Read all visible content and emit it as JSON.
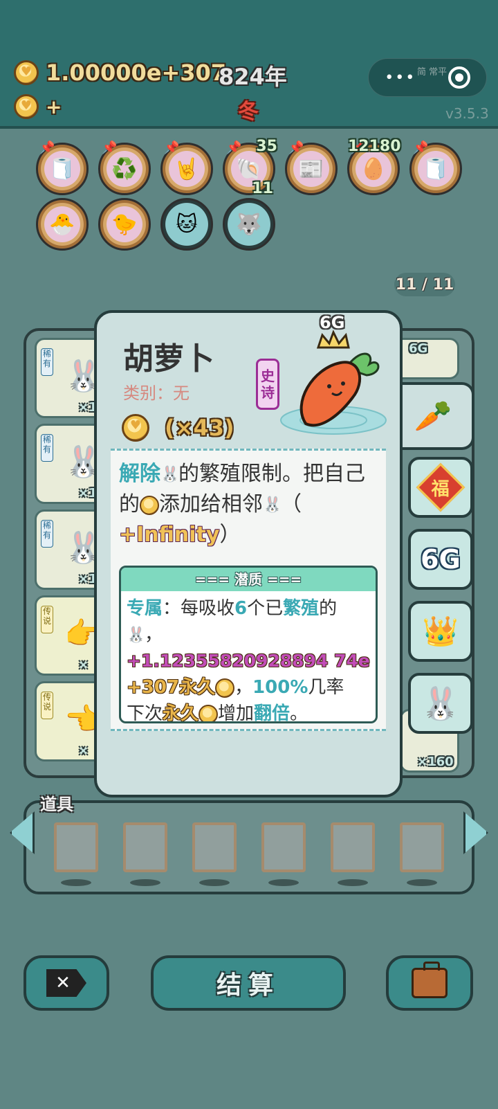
{
  "header": {
    "gold_value": "1.00000e+307",
    "gold_plus": "+",
    "year": "824年",
    "season": "冬",
    "version": "v3.5.3",
    "capsule_dots": "•••",
    "capsule_overlay": "简 常平"
  },
  "relics": [
    {
      "name": "tissue-box",
      "icon": "🧻"
    },
    {
      "name": "recycle",
      "icon": "♻️"
    },
    {
      "name": "rock-hand",
      "icon": "🤘"
    },
    {
      "name": "shell",
      "icon": "🐚",
      "count_top": "35",
      "count_bottom": "11"
    },
    {
      "name": "time-magazine",
      "icon": "📰"
    },
    {
      "name": "egg-tray",
      "icon": "🥚",
      "count_top": "12180"
    },
    {
      "name": "tissue-box-2",
      "icon": "🧻"
    },
    {
      "name": "chicks",
      "icon": "🐣"
    },
    {
      "name": "chick",
      "icon": "🐤"
    },
    {
      "name": "cat-dark",
      "icon": "🐱"
    },
    {
      "name": "husky-dark",
      "icon": "🐺"
    }
  ],
  "page_counter": "11 / 11",
  "grid": {
    "slots": [
      {
        "tag": "稀有",
        "mult": "×1",
        "icon": "🐰"
      },
      {
        "tag": "稀有",
        "mult": "×1",
        "icon": "🐰"
      },
      {
        "tag": "稀有",
        "mult": "×1",
        "icon": "🐰"
      },
      {
        "tag": "传说",
        "mult": "×",
        "icon": "👉"
      },
      {
        "tag": "传说",
        "mult": "×",
        "icon": "👈"
      }
    ],
    "right_slot_mult": "×160",
    "right_top_label": "6G"
  },
  "side_tabs": [
    {
      "name": "carrot",
      "icon": "🥕"
    },
    {
      "name": "fu",
      "label": "福"
    },
    {
      "name": "6g",
      "label": "6G"
    },
    {
      "name": "crown",
      "icon": "👑"
    },
    {
      "name": "rabbit",
      "icon": "🐰"
    }
  ],
  "card": {
    "title": "胡萝卜",
    "category": "类别：无",
    "rarity_line1": "史",
    "rarity_line2": "诗",
    "coin_mult": "(×43)",
    "badge_6g": "6G",
    "desc": {
      "p1_a": "解除",
      "p1_b": "的繁殖限制。把自己的",
      "p1_c": "添加给相邻",
      "p1_d": "（",
      "p1_e": "+Infinity",
      "p1_f": "）"
    },
    "potential": {
      "header": "=== 潜质 ===",
      "line1_a": "专属",
      "line1_b": "：每吸收",
      "line1_c": "6",
      "line1_d": "个已",
      "line1_e": "繁殖",
      "line1_f": "的",
      "line2": "，",
      "line3": "+1.12355820928894 74e",
      "line4_a": "+307永久",
      "line4_b": "，",
      "line4_c": "100%",
      "line4_d": "几率",
      "line5_a": "下次",
      "line5_b": "永久",
      "line5_c": "增加",
      "line5_d": "翻倍",
      "line5_e": "。"
    }
  },
  "items": {
    "label": "道具",
    "slot_count": 6
  },
  "buttons": {
    "settle": "结算",
    "delete_icon": "✕"
  }
}
